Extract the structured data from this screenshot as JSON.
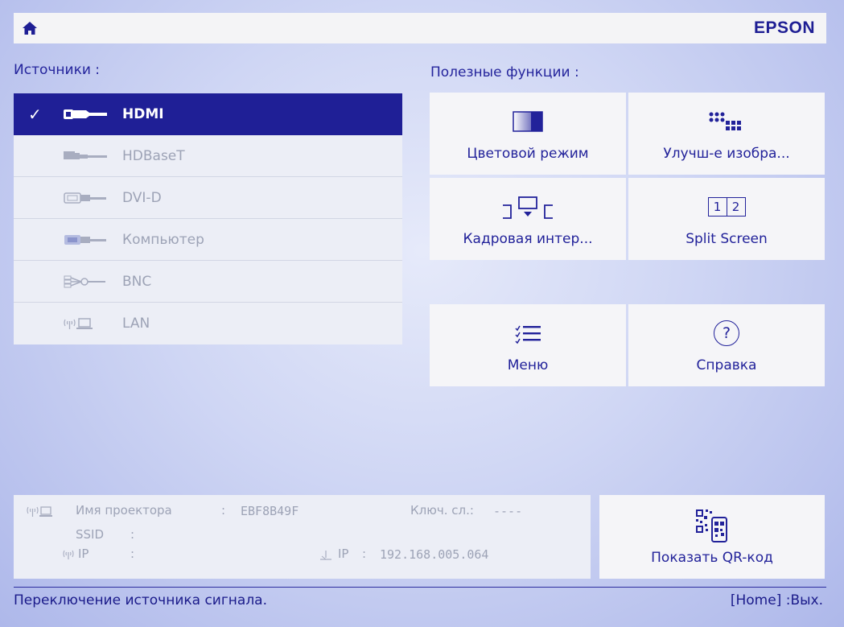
{
  "header": {
    "home_icon": "home-icon",
    "brand": "EPSON"
  },
  "sources": {
    "title": "Источники :",
    "items": [
      {
        "label": "HDMI",
        "icon": "hdmi-cable-icon",
        "selected": true
      },
      {
        "label": "HDBaseT",
        "icon": "hdbaset-cable-icon",
        "selected": false
      },
      {
        "label": "DVI-D",
        "icon": "dvi-connector-icon",
        "selected": false
      },
      {
        "label": "Компьютер",
        "icon": "vga-connector-icon",
        "selected": false
      },
      {
        "label": "BNC",
        "icon": "bnc-connector-icon",
        "selected": false
      },
      {
        "label": "LAN",
        "icon": "lan-wireless-icon",
        "selected": false
      }
    ]
  },
  "functions": {
    "title": "Полезные функции :",
    "tiles": [
      {
        "label": "Цветовой режим",
        "icon": "color-mode-icon"
      },
      {
        "label": "Улучш-е изобра...",
        "icon": "image-enhance-icon"
      },
      {
        "label": "Кадровая интер...",
        "icon": "frame-interpolation-icon"
      },
      {
        "label": "Split Screen",
        "icon": "split-screen-icon",
        "icon_text_left": "1",
        "icon_text_right": "2"
      },
      {
        "label": "Меню",
        "icon": "menu-list-icon"
      },
      {
        "label": "Справка",
        "icon": "help-icon",
        "icon_text": "?"
      }
    ]
  },
  "info": {
    "projector_name_label": "Имя проектора",
    "projector_name_sep": ":",
    "projector_name": "EBF8B49F",
    "keyword_label": "Ключ. сл.:",
    "keyword_value": "----",
    "ssid_label": "SSID",
    "ssid_sep": ":",
    "ip_label": "IP",
    "ip_sep": ":",
    "wired_ip_label": "IP",
    "wired_ip_sep": ":",
    "wired_ip_value": "192.168.005.064"
  },
  "qr": {
    "label": "Показать QR-код",
    "icon": "qr-phone-icon"
  },
  "footer": {
    "status": "Переключение источника сигнала.",
    "exit": "[Home] :Вых."
  }
}
